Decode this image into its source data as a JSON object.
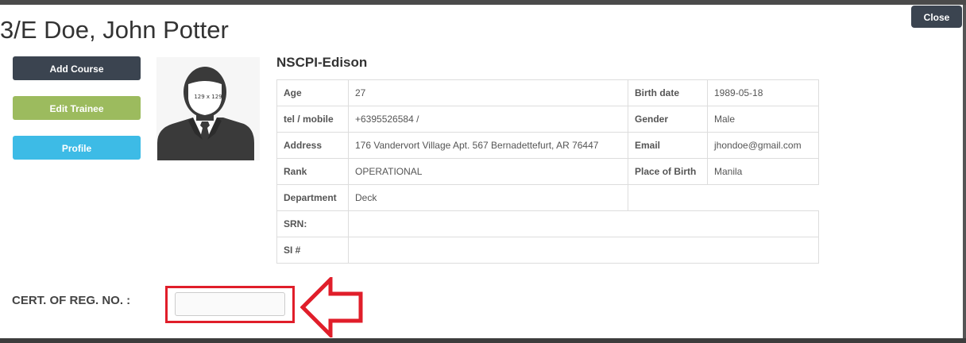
{
  "dialog": {
    "title": "3/E Doe, John Potter",
    "close_label": "Close"
  },
  "actions": {
    "add_course": "Add Course",
    "edit_trainee": "Edit Trainee",
    "profile": "Profile"
  },
  "avatar": {
    "placeholder_size": "129 x 129"
  },
  "organization": "NSCPI-Edison",
  "details": {
    "age_label": "Age",
    "age": "27",
    "birth_date_label": "Birth date",
    "birth_date": "1989-05-18",
    "mobile_label": "tel / mobile",
    "mobile": "+6395526584 /",
    "gender_label": "Gender",
    "gender": "Male",
    "address_label": "Address",
    "address": "176 Vandervort Village Apt. 567 Bernadettefurt, AR 76447",
    "email_label": "Email",
    "email": "jhondoe@gmail.com",
    "rank_label": "Rank",
    "rank": "OPERATIONAL",
    "place_of_birth_label": "Place of Birth",
    "place_of_birth": "Manila",
    "department_label": "Department",
    "department": "Deck",
    "srn_label": "SRN:",
    "srn": "",
    "si_label": "SI #",
    "si": ""
  },
  "cert_reg": {
    "label": "CERT. OF REG. NO. :",
    "value": "",
    "placeholder": ""
  },
  "colors": {
    "dark_button": "#3b4450",
    "edit_button": "#9cbb5e",
    "profile_button": "#3dbbe6",
    "highlight": "#e01e2a"
  }
}
